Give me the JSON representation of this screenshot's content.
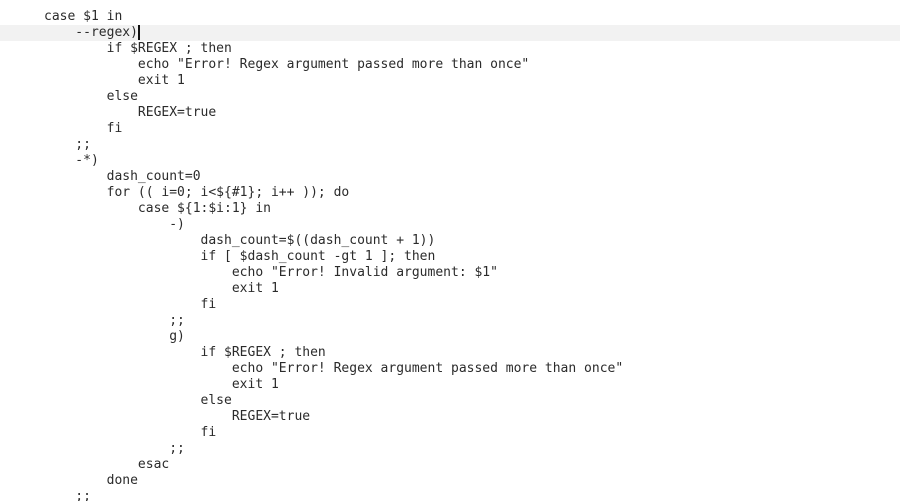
{
  "editor": {
    "current_line_index": 1,
    "lines": [
      "case $1 in",
      "    --regex)",
      "        if $REGEX ; then",
      "            echo \"Error! Regex argument passed more than once\"",
      "            exit 1",
      "        else",
      "            REGEX=true",
      "        fi",
      "    ;;",
      "    -*)",
      "        dash_count=0",
      "        for (( i=0; i<${#1}; i++ )); do",
      "            case ${1:$i:1} in",
      "                -)",
      "                    dash_count=$((dash_count + 1))",
      "                    if [ $dash_count -gt 1 ]; then",
      "                        echo \"Error! Invalid argument: $1\"",
      "                        exit 1",
      "                    fi",
      "                ;;",
      "                g)",
      "                    if $REGEX ; then",
      "                        echo \"Error! Regex argument passed more than once\"",
      "                        exit 1",
      "                    else",
      "                        REGEX=true",
      "                    fi",
      "                ;;",
      "            esac",
      "        done",
      "    ;;"
    ]
  }
}
